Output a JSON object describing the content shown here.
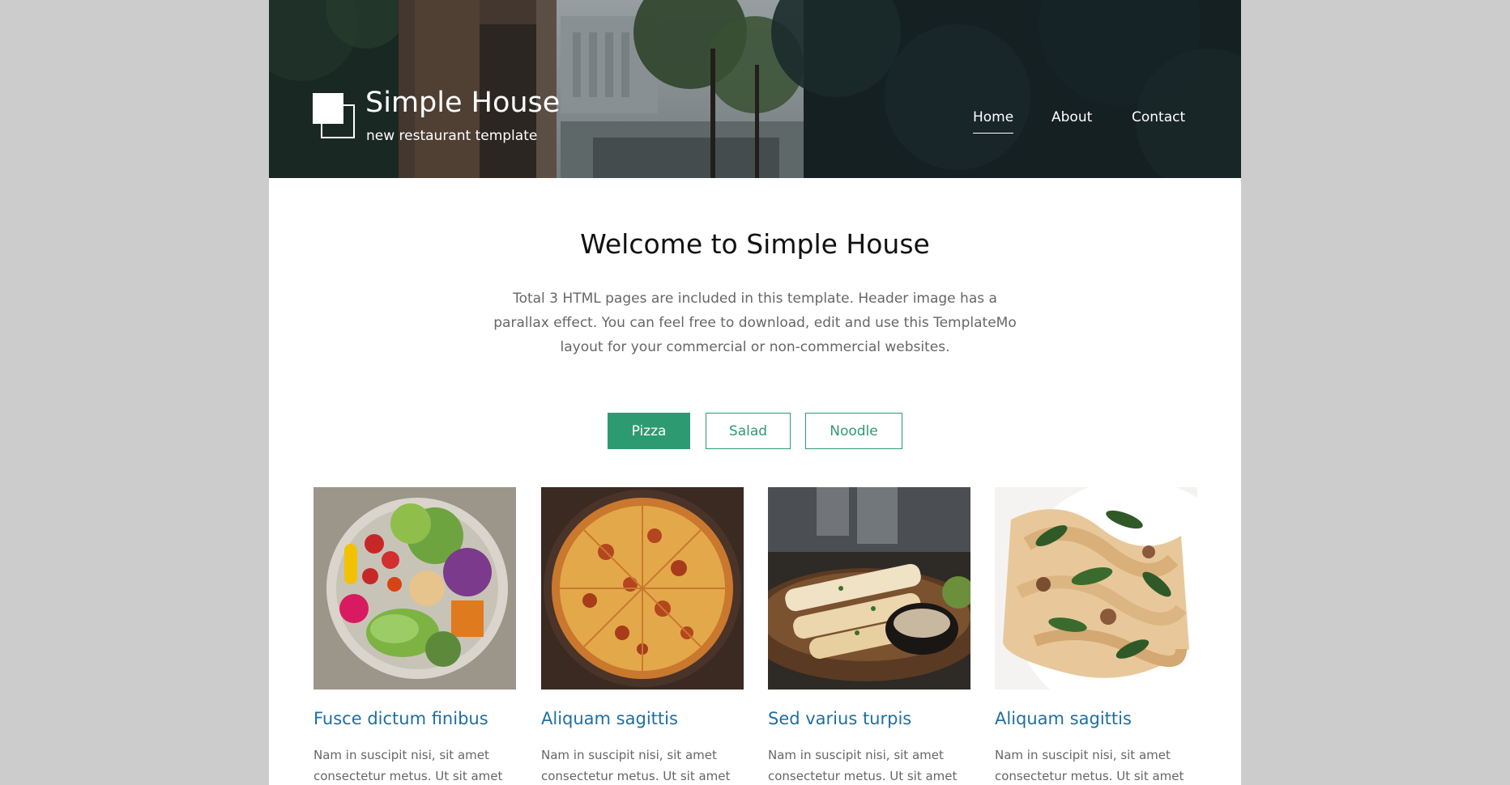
{
  "header": {
    "title": "Simple House",
    "subtitle": "new restaurant template",
    "nav": [
      {
        "label": "Home",
        "active": true
      },
      {
        "label": "About",
        "active": false
      },
      {
        "label": "Contact",
        "active": false
      }
    ]
  },
  "welcome": {
    "title": "Welcome to Simple House",
    "text": "Total 3 HTML pages are included in this template. Header image has a parallax effect. You can feel free to download, edit and use this TemplateMo layout for your commercial or non-commercial websites."
  },
  "tabs": [
    {
      "label": "Pizza",
      "active": true
    },
    {
      "label": "Salad",
      "active": false
    },
    {
      "label": "Noodle",
      "active": false
    }
  ],
  "cards": [
    {
      "title": "Fusce dictum finibus",
      "desc": "Nam in suscipit nisi, sit amet consectetur metus. Ut sit amet",
      "image": "salad-bowl-photo"
    },
    {
      "title": "Aliquam sagittis",
      "desc": "Nam in suscipit nisi, sit amet consectetur metus. Ut sit amet",
      "image": "pizza-photo"
    },
    {
      "title": "Sed varius turpis",
      "desc": "Nam in suscipit nisi, sit amet consectetur metus. Ut sit amet",
      "image": "grilled-seafood-photo"
    },
    {
      "title": "Aliquam sagittis",
      "desc": "Nam in suscipit nisi, sit amet consectetur metus. Ut sit amet",
      "image": "pasta-photo"
    }
  ],
  "colors": {
    "accent": "#2e9a72",
    "link": "#1e6fa3",
    "body_text": "#666666",
    "page_background": "#cccccc",
    "header_background": "#1d2b2e"
  }
}
